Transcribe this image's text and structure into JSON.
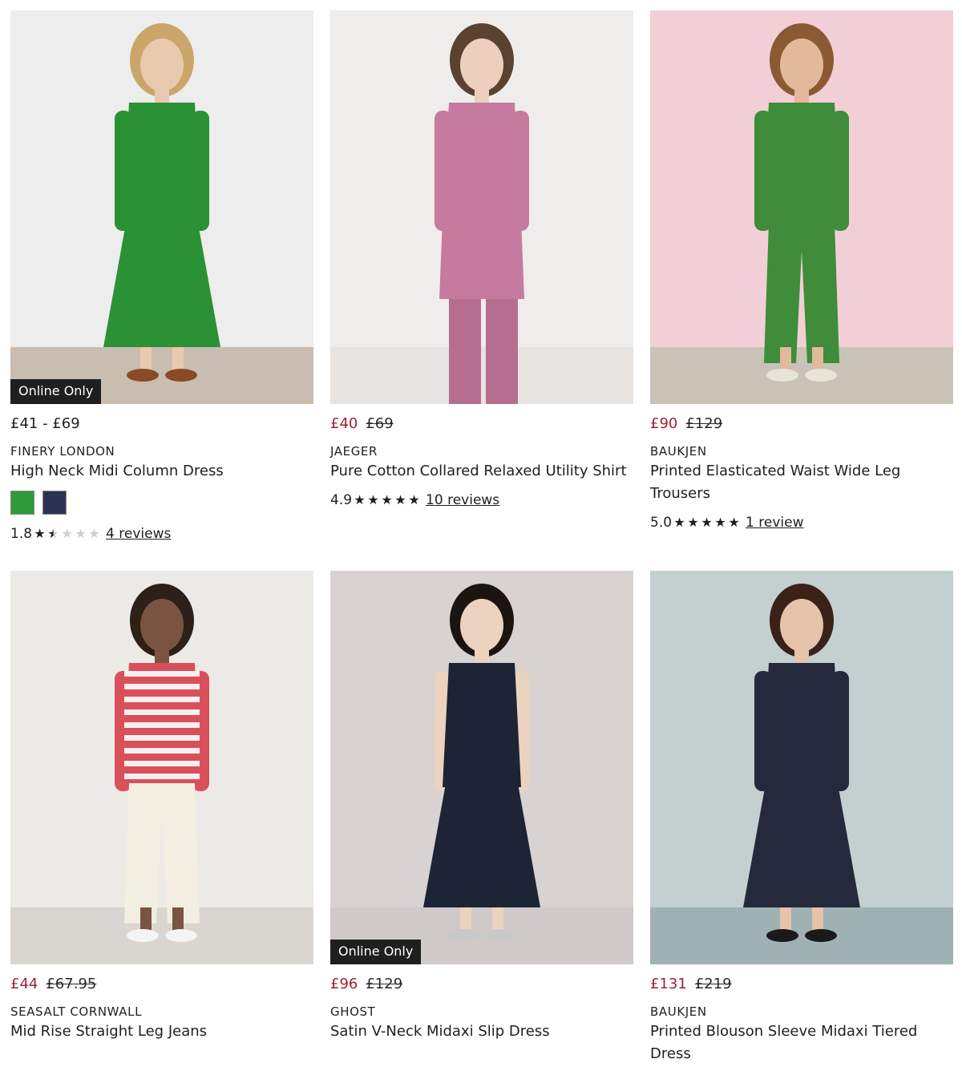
{
  "products": [
    {
      "badge": "Online Only",
      "price_range": "£41 - £69",
      "brand": "FINERY LONDON",
      "title": "High Neck Midi Column Dress",
      "swatches": [
        "#2e9b3a",
        "#2c3352"
      ],
      "rating_value": "1.8",
      "rating_stars": 1.8,
      "reviews": "4 reviews",
      "colors": {
        "bg_top": "#ededed",
        "bg_floor": "#c9bcb0",
        "garment": "#2b9135",
        "skin": "#e9c9ad",
        "hair": "#caa66a",
        "shoe": "#8a4a23"
      }
    },
    {
      "price_sale": "£40",
      "price_was": "£69",
      "brand": "JAEGER",
      "title": "Pure Cotton Collared Relaxed Utility Shirt",
      "rating_value": "4.9",
      "rating_stars": 5,
      "reviews": "10 reviews",
      "colors": {
        "bg_top": "#efedeb",
        "bg_floor": "#e6e3e0",
        "garment": "#c57a9e",
        "skin": "#ecd0bd",
        "hair": "#5a4130",
        "shoe": "#b66e8f"
      }
    },
    {
      "price_sale": "£90",
      "price_was": "£129",
      "brand": "BAUKJEN",
      "title": "Printed Elasticated Waist Wide Leg Trousers",
      "rating_value": "5.0",
      "rating_stars": 5,
      "reviews": "1 review",
      "colors": {
        "bg_top": "#f2cfd6",
        "bg_floor": "#c9c2b6",
        "garment": "#3f8c3b",
        "skin": "#e2b99a",
        "hair": "#8a5a33",
        "shoe": "#e9e4d8"
      }
    },
    {
      "price_sale": "£44",
      "price_was": "£67.95",
      "brand": "SEASALT CORNWALL",
      "title": "Mid Rise Straight Leg Jeans",
      "colors": {
        "bg_top": "#eceae6",
        "bg_floor": "#d9d6d1",
        "garment": "#f3eee2",
        "skin": "#7a5440",
        "hair": "#2c2018",
        "shoe": "#f4f4f4",
        "top": "#d9505a"
      }
    },
    {
      "badge": "Online Only",
      "price_sale": "£96",
      "price_was": "£129",
      "brand": "GHOST",
      "title": "Satin V-Neck Midaxi Slip Dress",
      "colors": {
        "bg_top": "#d8d2d1",
        "bg_floor": "#cfcac9",
        "garment": "#1c2436",
        "skin": "#ecd3bf",
        "hair": "#1c1410",
        "shoe": "#c9c9c9"
      }
    },
    {
      "price_sale": "£131",
      "price_was": "£219",
      "brand": "BAUKJEN",
      "title": "Printed Blouson Sleeve Midaxi Tiered Dress",
      "colors": {
        "bg_top": "#c3d0cf",
        "bg_floor": "#9fb1b2",
        "garment": "#242a3b",
        "skin": "#e6c4ab",
        "hair": "#3a2218",
        "shoe": "#1a1a1a"
      }
    }
  ]
}
